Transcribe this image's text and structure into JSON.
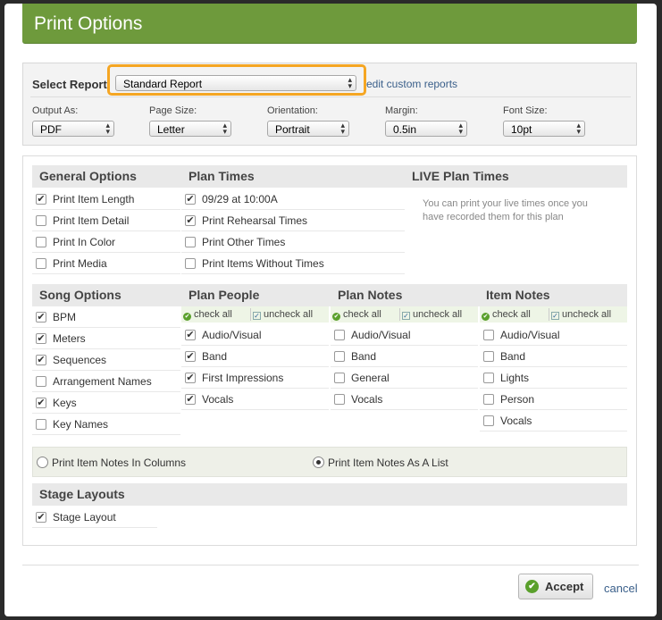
{
  "dialog": {
    "title": "Print Options"
  },
  "report": {
    "label": "Select Report",
    "selected": "Standard Report",
    "edit_link": "edit custom reports"
  },
  "settings": [
    {
      "label": "Output As:",
      "value": "PDF"
    },
    {
      "label": "Page Size:",
      "value": "Letter"
    },
    {
      "label": "Orientation:",
      "value": "Portrait"
    },
    {
      "label": "Margin:",
      "value": "0.5in"
    },
    {
      "label": "Font Size:",
      "value": "10pt"
    }
  ],
  "general": {
    "title": "General Options",
    "items": [
      {
        "label": "Print Item Length",
        "checked": true
      },
      {
        "label": "Print Item Detail",
        "checked": false
      },
      {
        "label": "Print In Color",
        "checked": false
      },
      {
        "label": "Print Media",
        "checked": false
      }
    ]
  },
  "plan_times": {
    "title": "Plan Times",
    "items": [
      {
        "label": "09/29 at 10:00A",
        "checked": true
      },
      {
        "label": "Print Rehearsal Times",
        "checked": true
      },
      {
        "label": "Print Other Times",
        "checked": false
      },
      {
        "label": "Print Items Without Times",
        "checked": false
      }
    ]
  },
  "live_times": {
    "title": "LIVE Plan Times",
    "note": "You can print your live times once you have recorded them for this plan"
  },
  "song_options": {
    "title": "Song Options",
    "items": [
      {
        "label": "BPM",
        "checked": true
      },
      {
        "label": "Meters",
        "checked": true
      },
      {
        "label": "Sequences",
        "checked": true
      },
      {
        "label": "Arrangement Names",
        "checked": false
      },
      {
        "label": "Keys",
        "checked": true
      },
      {
        "label": "Key Names",
        "checked": false
      }
    ]
  },
  "check_all": "check all",
  "uncheck_all": "uncheck all",
  "plan_people": {
    "title": "Plan People",
    "items": [
      {
        "label": "Audio/Visual",
        "checked": true
      },
      {
        "label": "Band",
        "checked": true
      },
      {
        "label": "First Impressions",
        "checked": true
      },
      {
        "label": "Vocals",
        "checked": true
      }
    ]
  },
  "plan_notes": {
    "title": "Plan Notes",
    "items": [
      {
        "label": "Audio/Visual",
        "checked": false
      },
      {
        "label": "Band",
        "checked": false
      },
      {
        "label": "General",
        "checked": false
      },
      {
        "label": "Vocals",
        "checked": false
      }
    ]
  },
  "item_notes": {
    "title": "Item Notes",
    "items": [
      {
        "label": "Audio/Visual",
        "checked": false
      },
      {
        "label": "Band",
        "checked": false
      },
      {
        "label": "Lights",
        "checked": false
      },
      {
        "label": "Person",
        "checked": false
      },
      {
        "label": "Vocals",
        "checked": false
      }
    ]
  },
  "notes_layout": {
    "columns_label": "Print Item Notes In Columns",
    "list_label": "Print Item Notes As A List",
    "selected": "list"
  },
  "stage_layouts": {
    "title": "Stage Layouts",
    "items": [
      {
        "label": "Stage Layout",
        "checked": true
      }
    ]
  },
  "footer": {
    "accept": "Accept",
    "cancel": "cancel"
  },
  "colors": {
    "title_bar": "#6e9a3c",
    "highlight": "#f5a623",
    "check_green": "#5aa02c"
  }
}
